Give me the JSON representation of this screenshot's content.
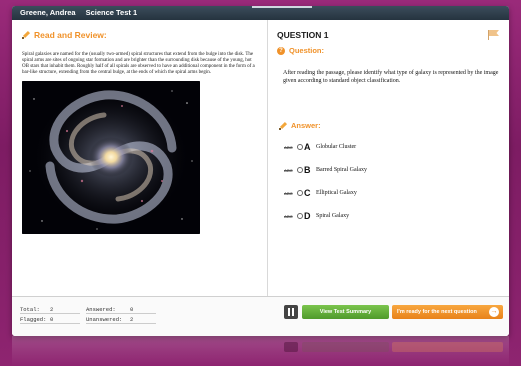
{
  "titlebar": {
    "student_name": "Greene, Andrea",
    "test_name": "Science Test 1"
  },
  "left_panel": {
    "heading": "Read and Review:",
    "passage": "Spiral galaxies are named for the (usually two-armed) spiral structures that extend from the bulge into the disk. The spiral arms are sites of ongoing star formation and are brighter than the surrounding disk because of the young, hot OB stars that inhabit them. Roughly half of all spirals are observed to have an additional component in the form of a bar-like structure, extending from the central bulge, at the ends of which the spiral arms begin."
  },
  "right_panel": {
    "question_number": "QUESTION 1",
    "question_label": "Question:",
    "question_icon": "?",
    "question_text": "After reading the passage, please identify what type of galaxy is represented by the image given according to standard object classification.",
    "answer_label": "Answer:",
    "options": [
      {
        "abc": "ABC",
        "letter": "A",
        "text": "Globular Cluster"
      },
      {
        "abc": "ABC",
        "letter": "B",
        "text": "Barred Spiral Galaxy"
      },
      {
        "abc": "ABC",
        "letter": "C",
        "text": "Elliptical Galaxy"
      },
      {
        "abc": "ABC",
        "letter": "D",
        "text": "Spiral Galaxy"
      }
    ]
  },
  "footer": {
    "total_label": "Total:",
    "total_value": "2",
    "answered_label": "Answered:",
    "answered_value": "0",
    "flagged_label": "Flagged:",
    "flagged_value": "0",
    "unanswered_label": "Unanswered:",
    "unanswered_value": "2",
    "summary_button": "View Test Summary",
    "next_button": "I'm ready for the next question",
    "next_icon": "→"
  },
  "icons": {
    "read_review": "pencil-icon",
    "question": "question-mark-icon",
    "answer": "pencil-icon",
    "flag": "flag-icon",
    "pause": "pause-icon",
    "next": "arrow-right-circle-icon"
  },
  "colors": {
    "accent_orange": "#f0922a",
    "summary_green": "#5fab35",
    "next_orange": "#f39a30",
    "background_magenta": "#8a2270",
    "titlebar": "#2f3f4c"
  }
}
